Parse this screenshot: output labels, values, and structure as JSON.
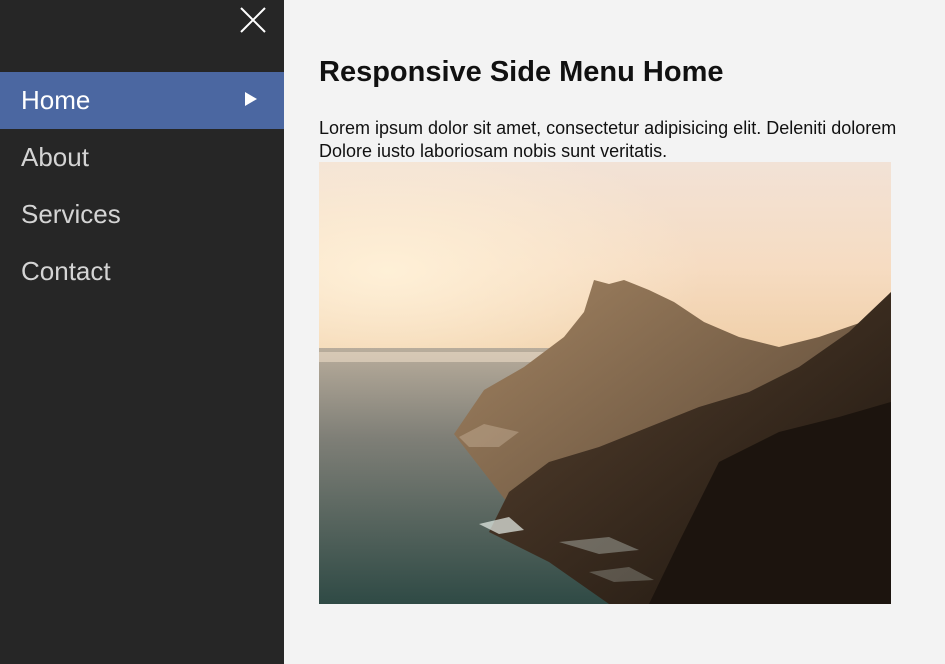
{
  "sidebar": {
    "close_label": "Close menu",
    "items": [
      {
        "label": "Home",
        "active": true
      },
      {
        "label": "About",
        "active": false
      },
      {
        "label": "Services",
        "active": false
      },
      {
        "label": "Contact",
        "active": false
      }
    ],
    "background": "#262626",
    "active_color": "#4b67a1"
  },
  "main": {
    "title": "Responsive Side Menu Home",
    "text_line1": "Lorem ipsum dolor sit amet, consectetur adipisicing elit. Deleniti dolorem",
    "text_line2": "Dolore iusto laboriosam nobis sunt veritatis.",
    "image_icon": "coastal-cliffs-sunset-photo",
    "background": "#f3f3f3"
  }
}
